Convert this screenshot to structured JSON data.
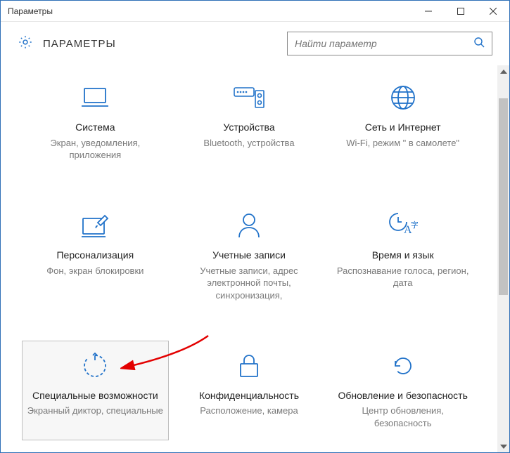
{
  "window": {
    "title": "Параметры"
  },
  "header": {
    "title": "ПАРАМЕТРЫ"
  },
  "search": {
    "placeholder": "Найти параметр"
  },
  "tiles": [
    {
      "title": "Система",
      "sub": "Экран, уведомления, приложения"
    },
    {
      "title": "Устройства",
      "sub": "Bluetooth, устройства"
    },
    {
      "title": "Сеть и Интернет",
      "sub": "Wi-Fi, режим \" в самолете\""
    },
    {
      "title": "Персонализация",
      "sub": "Фон, экран блокировки"
    },
    {
      "title": "Учетные записи",
      "sub": "Учетные записи, адрес электронной почты, синхронизация,"
    },
    {
      "title": "Время и язык",
      "sub": "Распознавание голоса, регион, дата"
    },
    {
      "title": "Специальные возможности",
      "sub": "Экранный диктор, специальные"
    },
    {
      "title": "Конфиденциальность",
      "sub": "Расположение, камера"
    },
    {
      "title": "Обновление и безопасность",
      "sub": "Центр обновления, безопасность"
    }
  ]
}
